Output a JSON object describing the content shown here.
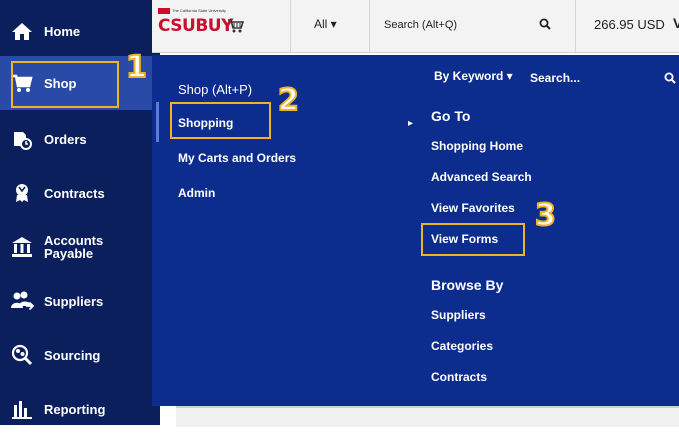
{
  "sidebar": {
    "items": [
      {
        "label": "Home",
        "icon": "home-icon"
      },
      {
        "label": "Shop",
        "icon": "cart-icon"
      },
      {
        "label": "Orders",
        "icon": "orders-icon"
      },
      {
        "label": "Contracts",
        "icon": "contracts-icon"
      },
      {
        "label": "Accounts",
        "label2": "Payable",
        "icon": "bank-icon"
      },
      {
        "label": "Suppliers",
        "icon": "suppliers-icon"
      },
      {
        "label": "Sourcing",
        "icon": "sourcing-icon"
      },
      {
        "label": "Reporting",
        "icon": "reporting-icon"
      }
    ]
  },
  "topbar": {
    "logo_small": "The California State University",
    "logo_text": "CSUBUY",
    "dropdown": "All ▾",
    "search_label": "Search (Alt+Q)",
    "amount": "266.95 USD",
    "amount_trail": "V"
  },
  "menu": {
    "section_title": "Shop (Alt+P)",
    "left_items": [
      "Shopping",
      "My Carts and Orders",
      "Admin"
    ],
    "keyword_dropdown": "By Keyword ▾",
    "search_placeholder": "Search...",
    "goto_heading": "Go To",
    "goto_items": [
      "Shopping Home",
      "Advanced Search",
      "View Favorites",
      "View Forms"
    ],
    "browse_heading": "Browse By",
    "browse_items": [
      "Suppliers",
      "Categories",
      "Contracts"
    ],
    "arrow": "▸"
  },
  "annotations": {
    "step1": "1",
    "step2": "2",
    "step3": "3",
    "highlight_color": "#f0b323"
  }
}
